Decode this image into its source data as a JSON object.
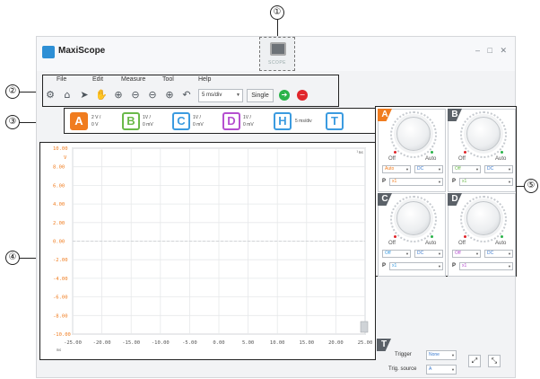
{
  "callouts": {
    "c1": "①",
    "c2": "②",
    "c3": "③",
    "c4": "④",
    "c5": "⑤"
  },
  "window": {
    "title": "MaxiScope",
    "controls": "– □ ✕",
    "accent": "#2d8fd5"
  },
  "scope_button": {
    "label": "SCOPE"
  },
  "menu": {
    "file": "File",
    "edit": "Edit",
    "measure": "Measure",
    "tool": "Tool",
    "help": "Help"
  },
  "toolbar": {
    "icons": [
      "gear-icon",
      "home-icon",
      "pointer-icon",
      "hand-icon",
      "zoom-in-icon",
      "zoom-out-icon",
      "zoom-x-icon",
      "zoom-y-icon",
      "undo-icon"
    ],
    "timebase": "5 ms/div",
    "single_label": "Single",
    "run_color": "#2bb34a",
    "stop_color": "#e0262b"
  },
  "channels": [
    {
      "letter": "A",
      "line1": "2 V /",
      "line2": "0 V",
      "color": "#f07c1f",
      "filled": true
    },
    {
      "letter": "B",
      "line1": "1V /",
      "line2": "0 mV",
      "color": "#6ab94a",
      "filled": false
    },
    {
      "letter": "C",
      "line1": "1V /",
      "line2": "0 mV",
      "color": "#3b9be0",
      "filled": false
    },
    {
      "letter": "D",
      "line1": "1V /",
      "line2": "0 mV",
      "color": "#b54fd0",
      "filled": false
    },
    {
      "letter": "H",
      "line1": "5 ms/div",
      "line2": "",
      "color": "#3b9be0",
      "filled": false
    },
    {
      "letter": "T",
      "line1": "",
      "line2": "",
      "color": "#3b9be0",
      "filled": false
    }
  ],
  "chart_data": {
    "type": "line",
    "title": "",
    "xlabel": "",
    "ylabel": "",
    "y_unit": "V",
    "x_unit": "ms",
    "xlim": [
      -25,
      25
    ],
    "ylim": [
      -10,
      10
    ],
    "x_ticks": [
      -25,
      -20,
      -15,
      -10,
      -5,
      0,
      5,
      10,
      15,
      20,
      25
    ],
    "y_ticks": [
      10,
      8,
      6,
      4,
      2,
      0,
      -2,
      -4,
      -6,
      -8,
      -10
    ],
    "x_tick_labels": [
      "-25.00",
      "-20.00",
      "-15.00",
      "-10.00",
      "-5.00",
      "0.00",
      "5.00",
      "10.00",
      "15.00",
      "20.00",
      "25.00"
    ],
    "y_tick_labels": [
      "10.00",
      "8.00",
      "6.00",
      "4.00",
      "2.00",
      "0.00",
      "-2.00",
      "-4.00",
      "-6.00",
      "-8.00",
      "-10.00"
    ],
    "grid": true,
    "corner_label": "¹ms",
    "series": [],
    "tick_color": "#f07c1f"
  },
  "channel_panels": [
    {
      "letter": "A",
      "color": "#f07c1f",
      "off": "Off",
      "auto": "Auto",
      "mode": "Auto",
      "coupling": "DC",
      "probe": "x1",
      "mode_color": "#f07c1f"
    },
    {
      "letter": "B",
      "color": "#5b6168",
      "off": "Off",
      "auto": "Auto",
      "mode": "Off",
      "coupling": "DC",
      "probe": "x1",
      "mode_color": "#6ab94a"
    },
    {
      "letter": "C",
      "color": "#5b6168",
      "off": "Off",
      "auto": "Auto",
      "mode": "Off",
      "coupling": "DC",
      "probe": "x1",
      "mode_color": "#3b9be0"
    },
    {
      "letter": "D",
      "color": "#5b6168",
      "off": "Off",
      "auto": "Auto",
      "mode": "Off",
      "coupling": "DC",
      "probe": "x1",
      "mode_color": "#b54fd0"
    }
  ],
  "probe_label": "P",
  "trigger": {
    "badge": "T",
    "trigger_label": "Trigger",
    "trigger_value": "None",
    "source_label": "Trig. source",
    "source_value": "A"
  }
}
